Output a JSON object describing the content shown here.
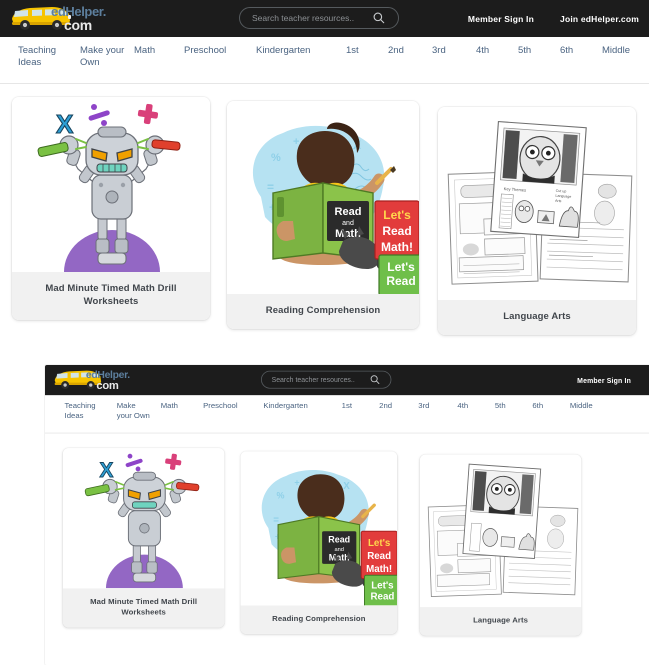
{
  "site": {
    "logo": {
      "name": "edhelper-logo",
      "brand_primary": "edHelper.",
      "brand_secondary": "com",
      "bus_color": "#f5c518",
      "alt": "edHelper.com school bus logo"
    },
    "search": {
      "placeholder": "Search teacher resources..",
      "value": "",
      "icon": "search-icon"
    },
    "auth": {
      "member_sign_in": "Member Sign In",
      "join": "Join edHelper.com"
    },
    "nav": [
      {
        "label": "Teaching Ideas"
      },
      {
        "label": "Make your Own"
      },
      {
        "label": "Math"
      },
      {
        "label": "Preschool"
      },
      {
        "label": "Kindergarten"
      },
      {
        "label": "1st"
      },
      {
        "label": "2nd"
      },
      {
        "label": "3rd"
      },
      {
        "label": "4th"
      },
      {
        "label": "5th"
      },
      {
        "label": "6th"
      },
      {
        "label": "Middle"
      }
    ],
    "cards": [
      {
        "title": "Mad Minute Timed Math Drill Worksheets",
        "illustration": "angry-robot-math-symbols"
      },
      {
        "title": "Reading Comprehension",
        "illustration": "child-reading-read-and-math-book",
        "book_text_line1": "Read",
        "book_text_line2": "and",
        "book_text_line3": "Math",
        "poster_line1": "Let's",
        "poster_line2": "Read",
        "poster_line3": "Math!"
      },
      {
        "title": "Language Arts",
        "illustration": "stacked-worksheet-pages-owl"
      }
    ]
  },
  "colors": {
    "topbar_bg": "#1c1c1c",
    "nav_link": "#4a6381",
    "card_caption_bg": "#f1f1f1",
    "card_caption_text": "#41464c",
    "page_bg": "#ffffff",
    "robot_body": "#b8bcc2",
    "robot_eye": "#f0a000",
    "hill_purple": "#9367c4",
    "book_green": "#7cb342",
    "poster_red": "#e23c3c",
    "sky_blue": "#b3e0f2"
  }
}
